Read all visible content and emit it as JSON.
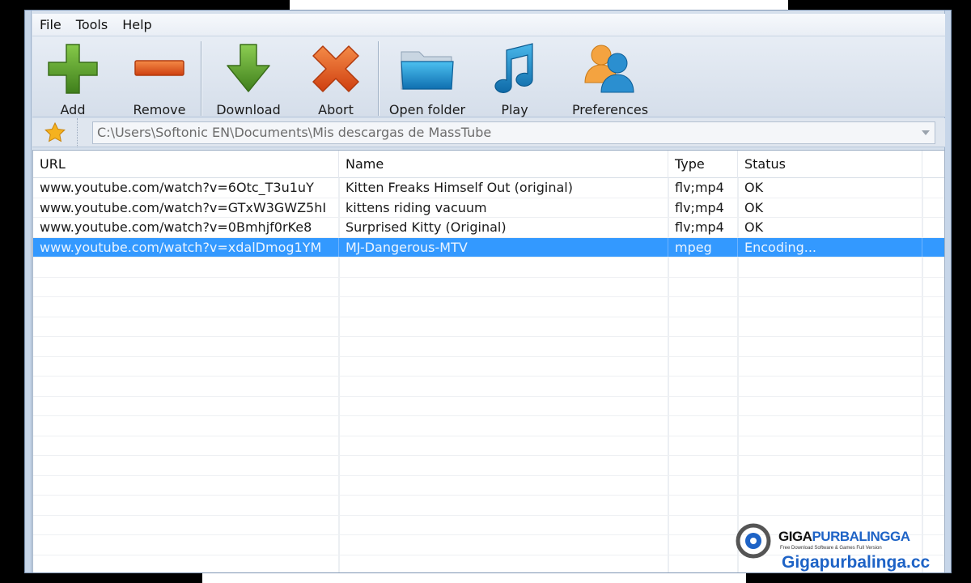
{
  "menu": [
    "File",
    "Tools",
    "Help"
  ],
  "toolbar": {
    "add": {
      "label": "Add",
      "icon": "plus-icon",
      "color": "#5a9e2b"
    },
    "remove": {
      "label": "Remove",
      "icon": "minus-icon",
      "color": "#e2571b"
    },
    "download": {
      "label": "Download",
      "icon": "download-arrow-icon",
      "color": "#5a9e2b"
    },
    "abort": {
      "label": "Abort",
      "icon": "x-icon",
      "color": "#e2571b"
    },
    "open_folder": {
      "label": "Open folder",
      "icon": "folder-icon",
      "color": "#1f93d6"
    },
    "play": {
      "label": "Play",
      "icon": "music-note-icon",
      "color": "#1f8fd0"
    },
    "preferences": {
      "label": "Preferences",
      "icon": "users-icon",
      "color": "#2a8ecf"
    }
  },
  "path": {
    "favorite_icon": "star-icon",
    "value": "C:\\Users\\Softonic EN\\Documents\\Mis descargas de MassTube"
  },
  "table": {
    "columns": [
      "URL",
      "Name",
      "Type",
      "Status"
    ],
    "rows": [
      {
        "url": "www.youtube.com/watch?v=6Otc_T3u1uY",
        "name": "Kitten Freaks Himself Out (original)",
        "type": "flv;mp4",
        "status": "OK"
      },
      {
        "url": "www.youtube.com/watch?v=GTxW3GWZ5hI",
        "name": "kittens riding vacuum",
        "type": "flv;mp4",
        "status": "OK"
      },
      {
        "url": "www.youtube.com/watch?v=0Bmhjf0rKe8",
        "name": "Surprised Kitty (Original)",
        "type": "flv;mp4",
        "status": "OK"
      },
      {
        "url": "www.youtube.com/watch?v=xdalDmog1YM",
        "name": "MJ-Dangerous-MTV",
        "type": "mpeg",
        "status": "Encoding...",
        "selected": true
      }
    ]
  },
  "watermark": {
    "brand_part1": "GIGA",
    "brand_part2": "PURBALINGGA",
    "tagline": "Free Download Software & Games Full Version",
    "url": "Gigapurbalinga.cc"
  },
  "colors": {
    "selection": "#3399ff",
    "accent": "#1e63c6"
  }
}
